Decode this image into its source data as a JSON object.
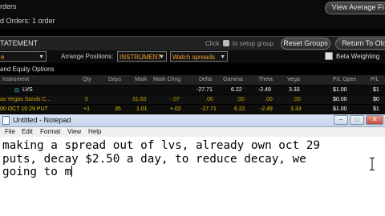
{
  "top": {
    "line1": "rders",
    "line2": "d Orders: 1 order",
    "view_average_btn": "View Average Fi"
  },
  "statement": {
    "title": "TATEMENT",
    "hint": "Click",
    "hint2": "to setup group",
    "reset_groups": "Reset Groups",
    "return_btn": "Return To Old"
  },
  "arrange": {
    "dd1": "e",
    "label": "Arrange Positions:",
    "instrument": "INSTRUMENT",
    "watch": "Watch spreads",
    "beta": "Beta Weighting"
  },
  "section": "and Equity Options",
  "columns": {
    "instrument": "Instrument",
    "qty": "Qty",
    "days": "Days",
    "mark": "Mark",
    "mark_chng": "Mark Chng",
    "delta": "Delta",
    "gamma": "Gamma",
    "theta": "Theta",
    "vega": "Vega",
    "pl_open": "P/L Open",
    "pl_day": "P/L"
  },
  "rows": [
    {
      "instrument": "LVS",
      "qty": "",
      "days": "",
      "mark": "",
      "mark_chng": "",
      "delta": "-27.71",
      "gamma": "6.22",
      "theta": "-2.49",
      "vega": "3.33",
      "pl_open": "$1.00",
      "pl_day": "$1"
    },
    {
      "instrument": "as Vegas Sands C...",
      "qty": "0",
      "days": "",
      "mark": "31.60",
      "mark_chng": "-.07",
      "delta": ".00",
      "gamma": ".00",
      "theta": ".00",
      "vega": ".00",
      "pl_open": "$0.00",
      "pl_day": "$0"
    },
    {
      "instrument": "00 OCT 10 29 PUT",
      "qty": "+1",
      "days": "35",
      "mark": "1.01",
      "mark_chng": "+.02",
      "delta": "-27.71",
      "gamma": "6.22",
      "theta": "-2.49",
      "vega": "3.33",
      "pl_open": "$1.00",
      "pl_day": "$1"
    }
  ],
  "notepad": {
    "title": "Untitled - Notepad",
    "menu": [
      "File",
      "Edit",
      "Format",
      "View",
      "Help"
    ],
    "line1": "making a spread out of lvs, already own oct 29",
    "line2": "puts, decay $2.50 a day, to reduce decay, we",
    "line3": "going to m"
  },
  "colors": {
    "orange": "#f0a030",
    "cyan": "#39c6e8",
    "yellow_row": "#d8c200",
    "row_text": "#c8c8c8"
  }
}
